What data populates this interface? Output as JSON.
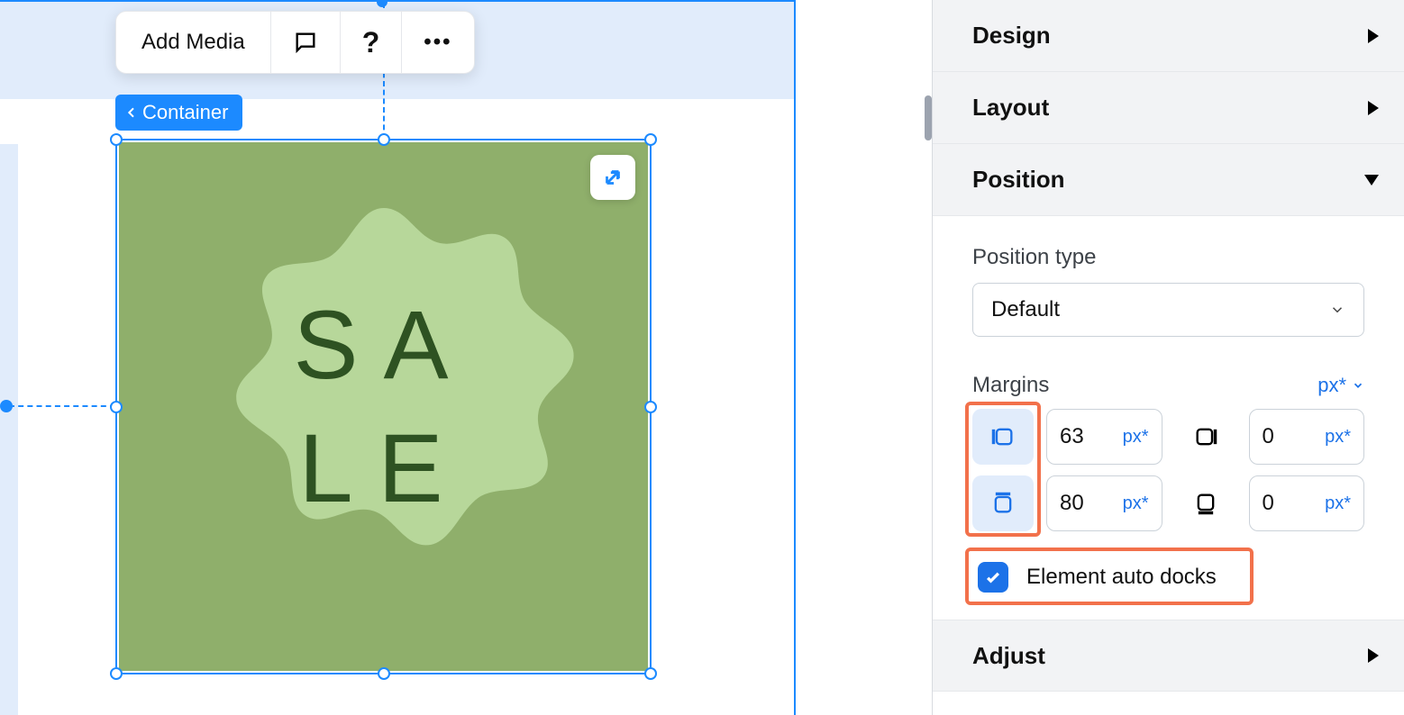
{
  "toolbar": {
    "add_media": "Add Media"
  },
  "breadcrumb": {
    "container": "Container"
  },
  "sale": {
    "line1": "SA",
    "line2": "LE"
  },
  "sections": {
    "design": "Design",
    "layout": "Layout",
    "position": "Position",
    "adjust": "Adjust"
  },
  "position": {
    "type_label": "Position type",
    "type_value": "Default",
    "margins_label": "Margins",
    "margins_unit": "px*",
    "left_value": "63",
    "left_unit": "px*",
    "top_value": "80",
    "top_unit": "px*",
    "right_value": "0",
    "right_unit": "px*",
    "bottom_value": "0",
    "bottom_unit": "px*",
    "auto_docks": "Element auto docks"
  }
}
